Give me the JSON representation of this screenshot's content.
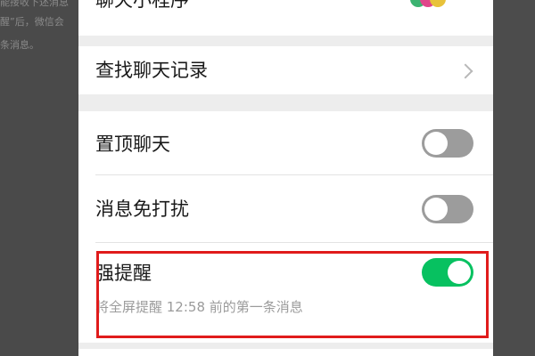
{
  "background": {
    "article_lines": [
      "能接收下述消息",
      "醒”后，微信会",
      "条消息。"
    ]
  },
  "items": {
    "mini_program": {
      "label": "聊天小程序"
    },
    "search_history": {
      "label": "查找聊天记录"
    },
    "pin_chat": {
      "label": "置顶聊天",
      "enabled": false
    },
    "mute": {
      "label": "消息免打扰",
      "enabled": false
    },
    "strong_reminder": {
      "label": "强提醒",
      "enabled": true,
      "description": "将全屏提醒 12:58 前的第一条消息"
    }
  },
  "colors": {
    "toggle_on": "#07c160",
    "toggle_off": "#9c9c9c",
    "highlight": "#e01b1b"
  }
}
